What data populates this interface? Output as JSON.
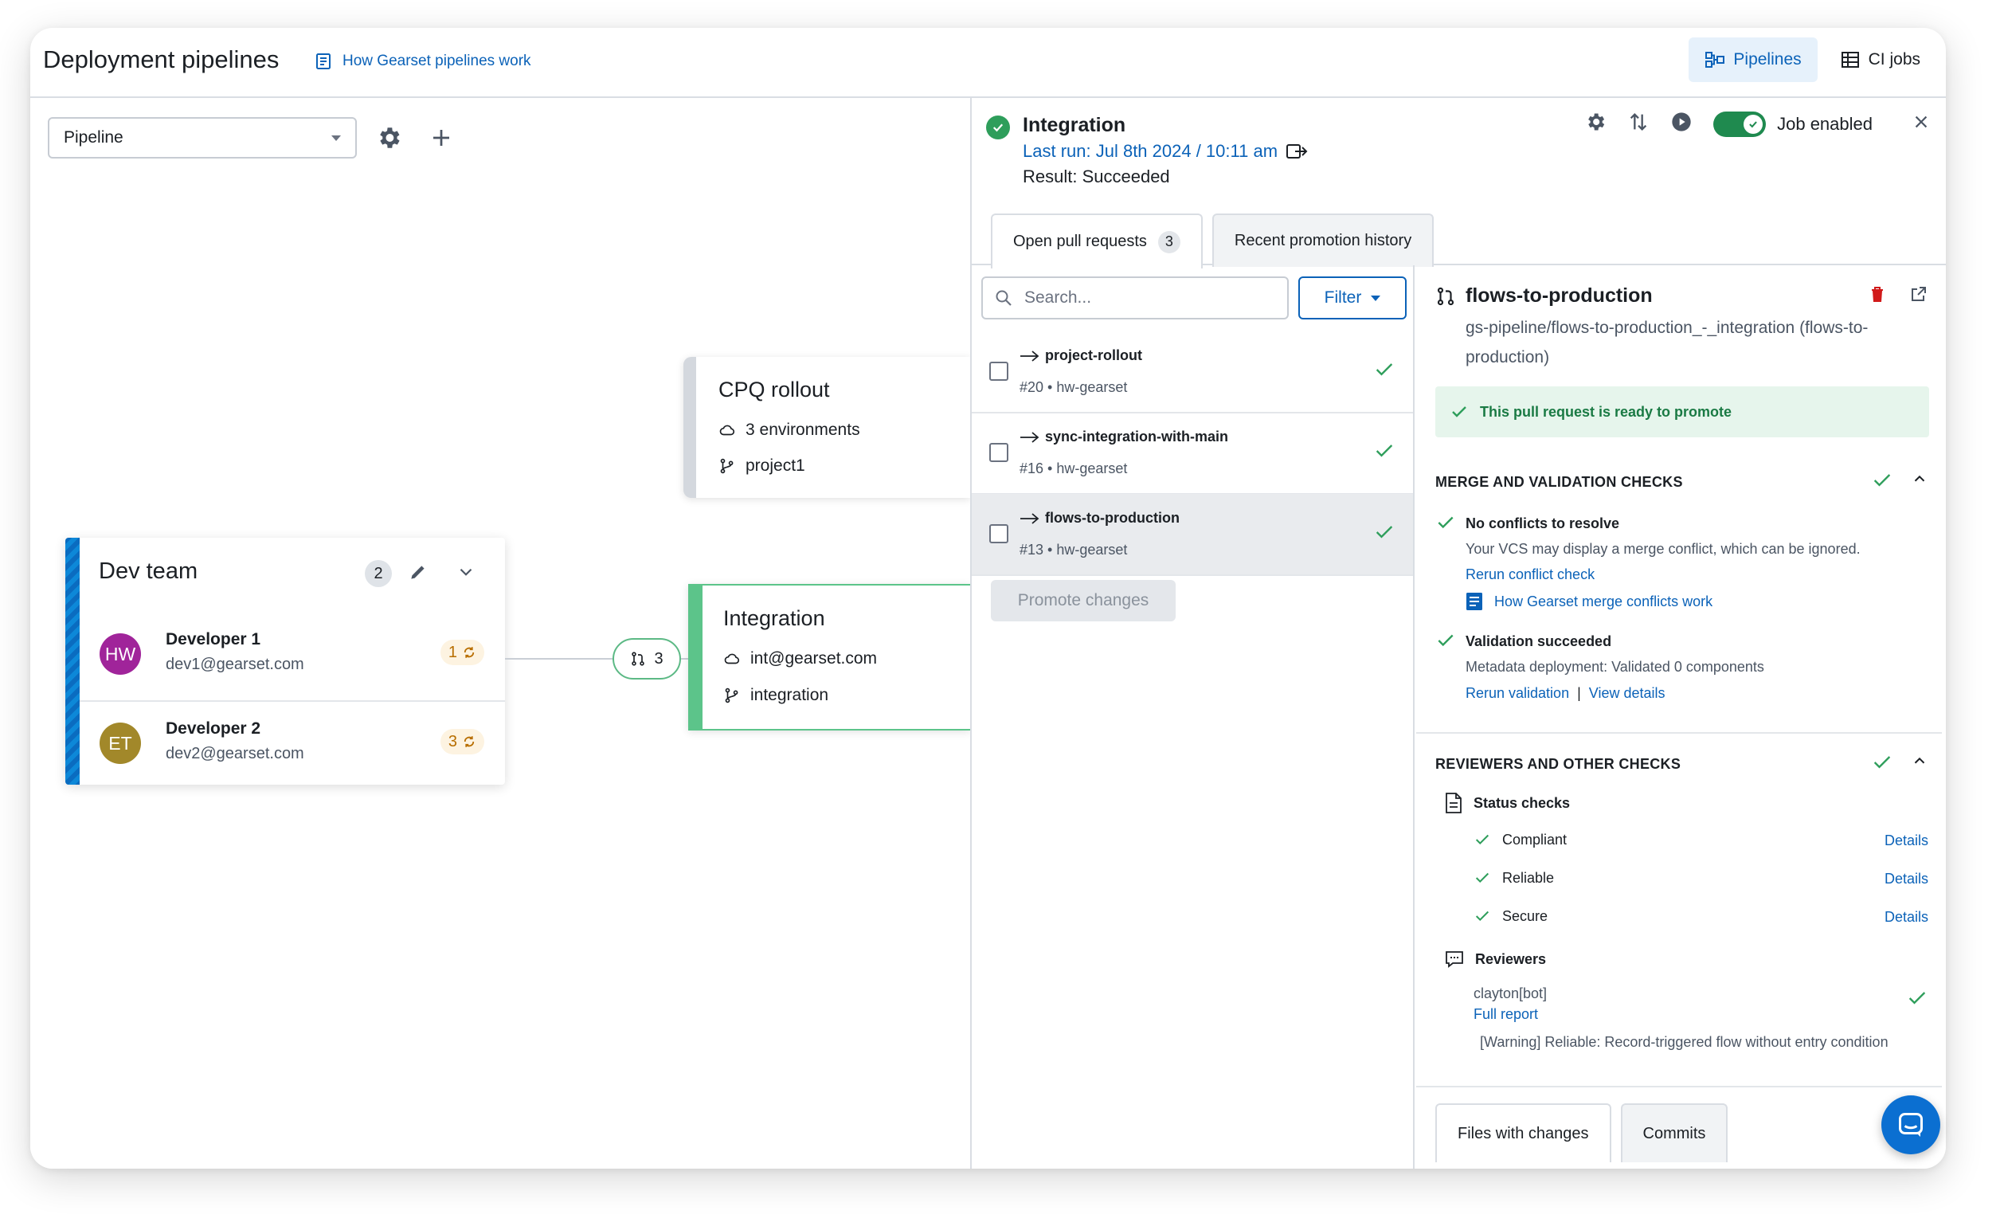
{
  "header": {
    "title": "Deployment pipelines",
    "help_link": "How Gearset pipelines work",
    "views": [
      {
        "label": "Pipelines",
        "icon": "pipeline-icon",
        "active": true
      },
      {
        "label": "CI jobs",
        "icon": "grid-icon",
        "active": false
      }
    ]
  },
  "canvas": {
    "pipeline_select": "Pipeline",
    "nodes": {
      "cpq": {
        "title": "CPQ rollout",
        "environments": "3 environments",
        "branch": "project1"
      },
      "integration": {
        "title": "Integration",
        "org": "int@gearset.com",
        "branch": "integration"
      },
      "devteam": {
        "title": "Dev team",
        "count": "2",
        "developers": [
          {
            "initials": "HW",
            "name": "Developer 1",
            "email": "dev1@gearset.com",
            "sync": "1",
            "color": "#a0249a"
          },
          {
            "initials": "ET",
            "name": "Developer 2",
            "email": "dev2@gearset.com",
            "sync": "3",
            "color": "#a2882a"
          }
        ]
      }
    },
    "pr_bubble_count": "3"
  },
  "panel": {
    "title": "Integration",
    "last_run": "Last run: Jul 8th 2024 / 10:11 am",
    "result": "Result: Succeeded",
    "job_enabled_label": "Job enabled",
    "tabs": [
      {
        "label": "Open pull requests",
        "count": "3",
        "active": true
      },
      {
        "label": "Recent promotion history",
        "active": false
      }
    ],
    "search_placeholder": "Search...",
    "filter_label": "Filter",
    "pull_requests": [
      {
        "name": "project-rollout",
        "sub": "#20 • hw-gearset"
      },
      {
        "name": "sync-integration-with-main",
        "sub": "#16 • hw-gearset"
      },
      {
        "name": "flows-to-production",
        "sub": "#13 • hw-gearset"
      }
    ],
    "promote_label": "Promote changes"
  },
  "detail": {
    "name": "flows-to-production",
    "branch": "gs-pipeline/flows-to-production_-_integration (flows-to-production)",
    "ready": "This pull request is ready to promote",
    "merge_section": "MERGE AND VALIDATION CHECKS",
    "no_conflicts_title": "No conflicts to resolve",
    "no_conflicts_text": "Your VCS may display a merge conflict, which can be ignored.",
    "rerun_conflict": "Rerun conflict check",
    "merge_doc_link": "How Gearset merge conflicts work",
    "validation_title": "Validation succeeded",
    "validation_text": "Metadata deployment: Validated 0 components",
    "rerun_validation": "Rerun validation",
    "separator": "|",
    "view_details": "View details",
    "reviewers_section": "REVIEWERS AND OTHER CHECKS",
    "status_checks_label": "Status checks",
    "status_checks": [
      {
        "label": "Compliant",
        "link": "Details"
      },
      {
        "label": "Reliable",
        "link": "Details"
      },
      {
        "label": "Secure",
        "link": "Details"
      }
    ],
    "reviewers_label": "Reviewers",
    "reviewer_name": "clayton[bot]",
    "full_report": "Full report",
    "warning": "[Warning] Reliable: Record-triggered flow without entry condition",
    "bottom_tabs": [
      {
        "label": "Files with changes",
        "active": true
      },
      {
        "label": "Commits",
        "active": false
      }
    ]
  },
  "colors": {
    "accent": "#0b62b8",
    "success": "#2e9e5b",
    "devteam_stripe": "#0a6cc0",
    "integration_bar": "#5cc48a"
  }
}
